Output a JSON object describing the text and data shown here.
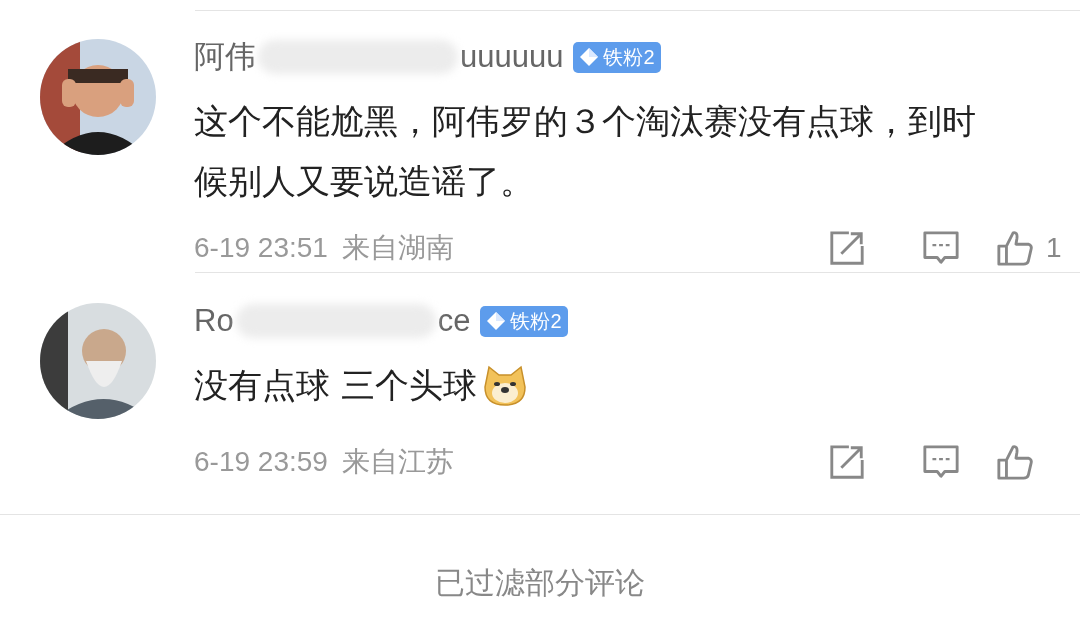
{
  "comments": [
    {
      "name_start": "阿伟",
      "name_end": "uuuuuu",
      "badge": "铁粉2",
      "text": "这个不能尬黑，阿伟罗的３个淘汰赛没有点球，到时候别人又要说造谣了。",
      "emoji": false,
      "time": "6-19 23:51",
      "location": "来自湖南",
      "likes": "1"
    },
    {
      "name_start": "Ro",
      "name_end": "ce",
      "badge": "铁粉2",
      "text": "没有点球 三个头球",
      "emoji": true,
      "time": "6-19 23:59",
      "location": "来自江苏"
    }
  ],
  "footer": "已过滤部分评论"
}
